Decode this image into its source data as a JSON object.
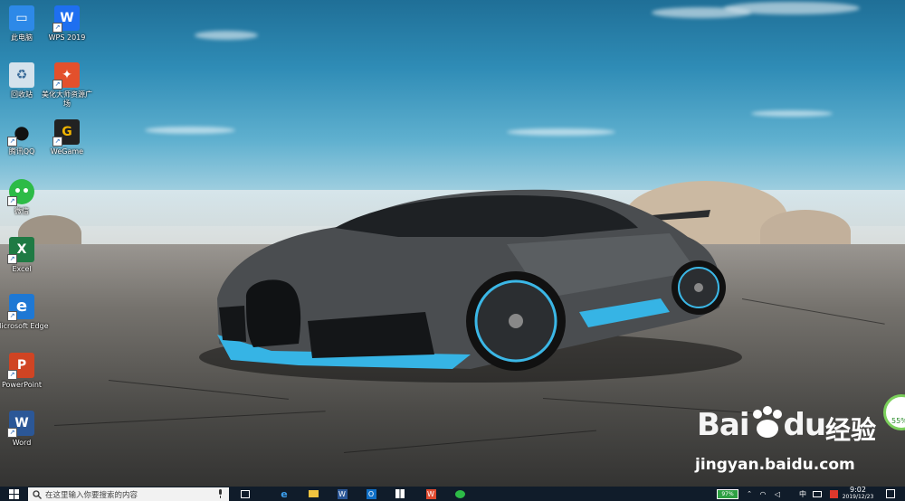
{
  "desktop": {
    "icons": [
      {
        "label": "此电脑",
        "icon": "computer-icon",
        "color": "#2d89e8"
      },
      {
        "label": "WPS 2019",
        "icon": "wps-icon",
        "color": "#1e6ff0"
      },
      {
        "label": "回收站",
        "icon": "recycle-bin-icon",
        "color": "#bcd0e0"
      },
      {
        "label": "美化大师资源广场",
        "icon": "beautify-master-icon",
        "color": "#e3502c"
      },
      {
        "label": "腾讯QQ",
        "icon": "qq-icon",
        "color": "#111111"
      },
      {
        "label": "WeGame",
        "icon": "wegame-icon",
        "color": "#f0b400"
      },
      {
        "label": "微信",
        "icon": "wechat-icon",
        "color": "#2dbb47"
      },
      {
        "label": "Excel",
        "icon": "excel-icon",
        "color": "#1f7a44"
      },
      {
        "label": "Microsoft Edge",
        "icon": "edge-icon",
        "color": "#1e78d4"
      },
      {
        "label": "PowerPoint",
        "icon": "powerpoint-icon",
        "color": "#d04423"
      },
      {
        "label": "Word",
        "icon": "word-icon",
        "color": "#2b5797"
      }
    ]
  },
  "watermark": {
    "brand": "Bai",
    "brand_tail": "du",
    "cn": "经验",
    "url": "jingyan.baidu.com"
  },
  "badge": {
    "percent": "55%"
  },
  "taskbar": {
    "search_placeholder": "在这里输入你要搜索的内容",
    "pinned": [
      "task-view-icon",
      "edge-icon",
      "file-explorer-icon",
      "word-icon",
      "outlook-icon",
      "store-icon",
      "wps-icon",
      "wechat-icon"
    ],
    "battery": "97%",
    "ime": "中",
    "time": "9:02",
    "date": "2019/12/23"
  }
}
